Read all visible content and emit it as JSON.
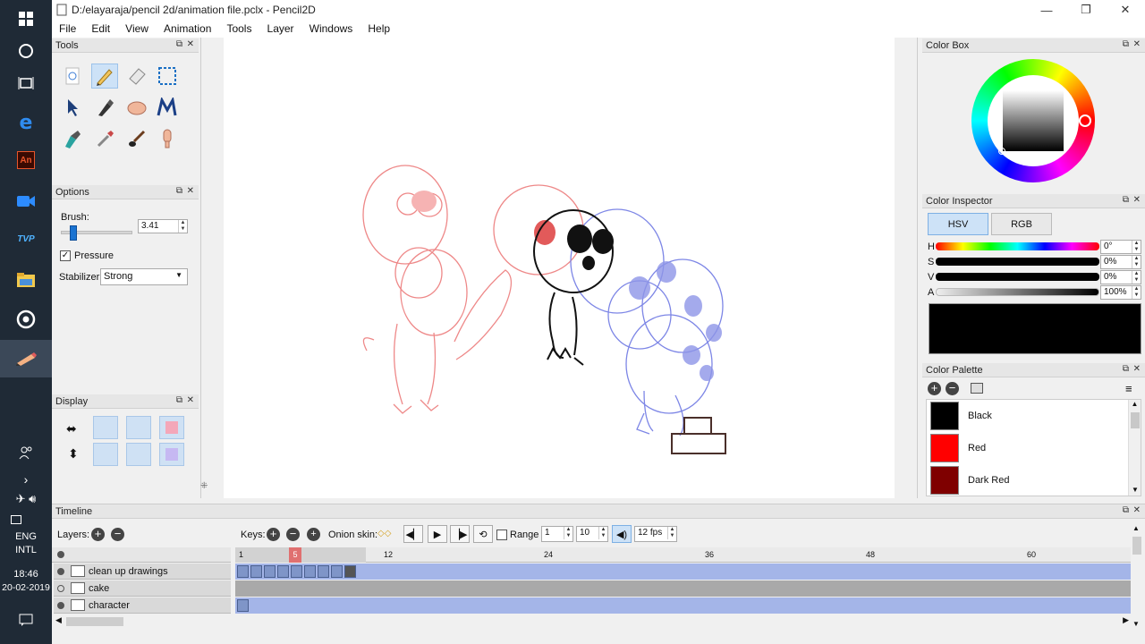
{
  "window": {
    "title": "D:/elayaraja/pencil 2d/animation file.pclx - Pencil2D",
    "minimize": "—",
    "maximize": "❐",
    "close": "✕"
  },
  "menu": [
    "File",
    "Edit",
    "View",
    "Animation",
    "Tools",
    "Layer",
    "Windows",
    "Help"
  ],
  "taskbar": {
    "lang": "ENG",
    "intl": "INTL",
    "time": "18:46",
    "date": "20-02-2019",
    "an_label": "An",
    "tvp_label": "TVP"
  },
  "tools_panel": {
    "title": "Tools"
  },
  "options_panel": {
    "title": "Options",
    "brush_label": "Brush:",
    "brush_value": "3.41",
    "brush_slider_fraction": 0.12,
    "pressure_label": "Pressure",
    "pressure_checked": true,
    "stabilizer_label": "Stabilizer",
    "stabilizer_value": "Strong"
  },
  "display_panel": {
    "title": "Display"
  },
  "color_box": {
    "title": "Color Box"
  },
  "color_inspector": {
    "title": "Color Inspector",
    "tab_hsv": "HSV",
    "tab_rgb": "RGB",
    "h_label": "H",
    "h_value": "0°",
    "s_label": "S",
    "s_value": "0%",
    "v_label": "V",
    "v_value": "0%",
    "a_label": "A",
    "a_value": "100%",
    "preview_color": "#000000"
  },
  "color_palette": {
    "title": "Color Palette",
    "items": [
      {
        "name": "Black",
        "color": "#000000"
      },
      {
        "name": "Red",
        "color": "#ff0000"
      },
      {
        "name": "Dark Red",
        "color": "#7f0000"
      }
    ]
  },
  "timeline": {
    "title": "Timeline",
    "layers_label": "Layers:",
    "keys_label": "Keys:",
    "onion_label": "Onion skin:",
    "range_label": "Range",
    "range_start": "1",
    "range_end": "10",
    "fps": "12 fps",
    "current_frame": "5",
    "ruler": [
      "1",
      "12",
      "24",
      "36",
      "48",
      "60"
    ],
    "layers": [
      {
        "name": "clean up drawings",
        "keys": 9
      },
      {
        "name": "cake",
        "keys": 0
      },
      {
        "name": "character",
        "keys": 1
      }
    ]
  }
}
